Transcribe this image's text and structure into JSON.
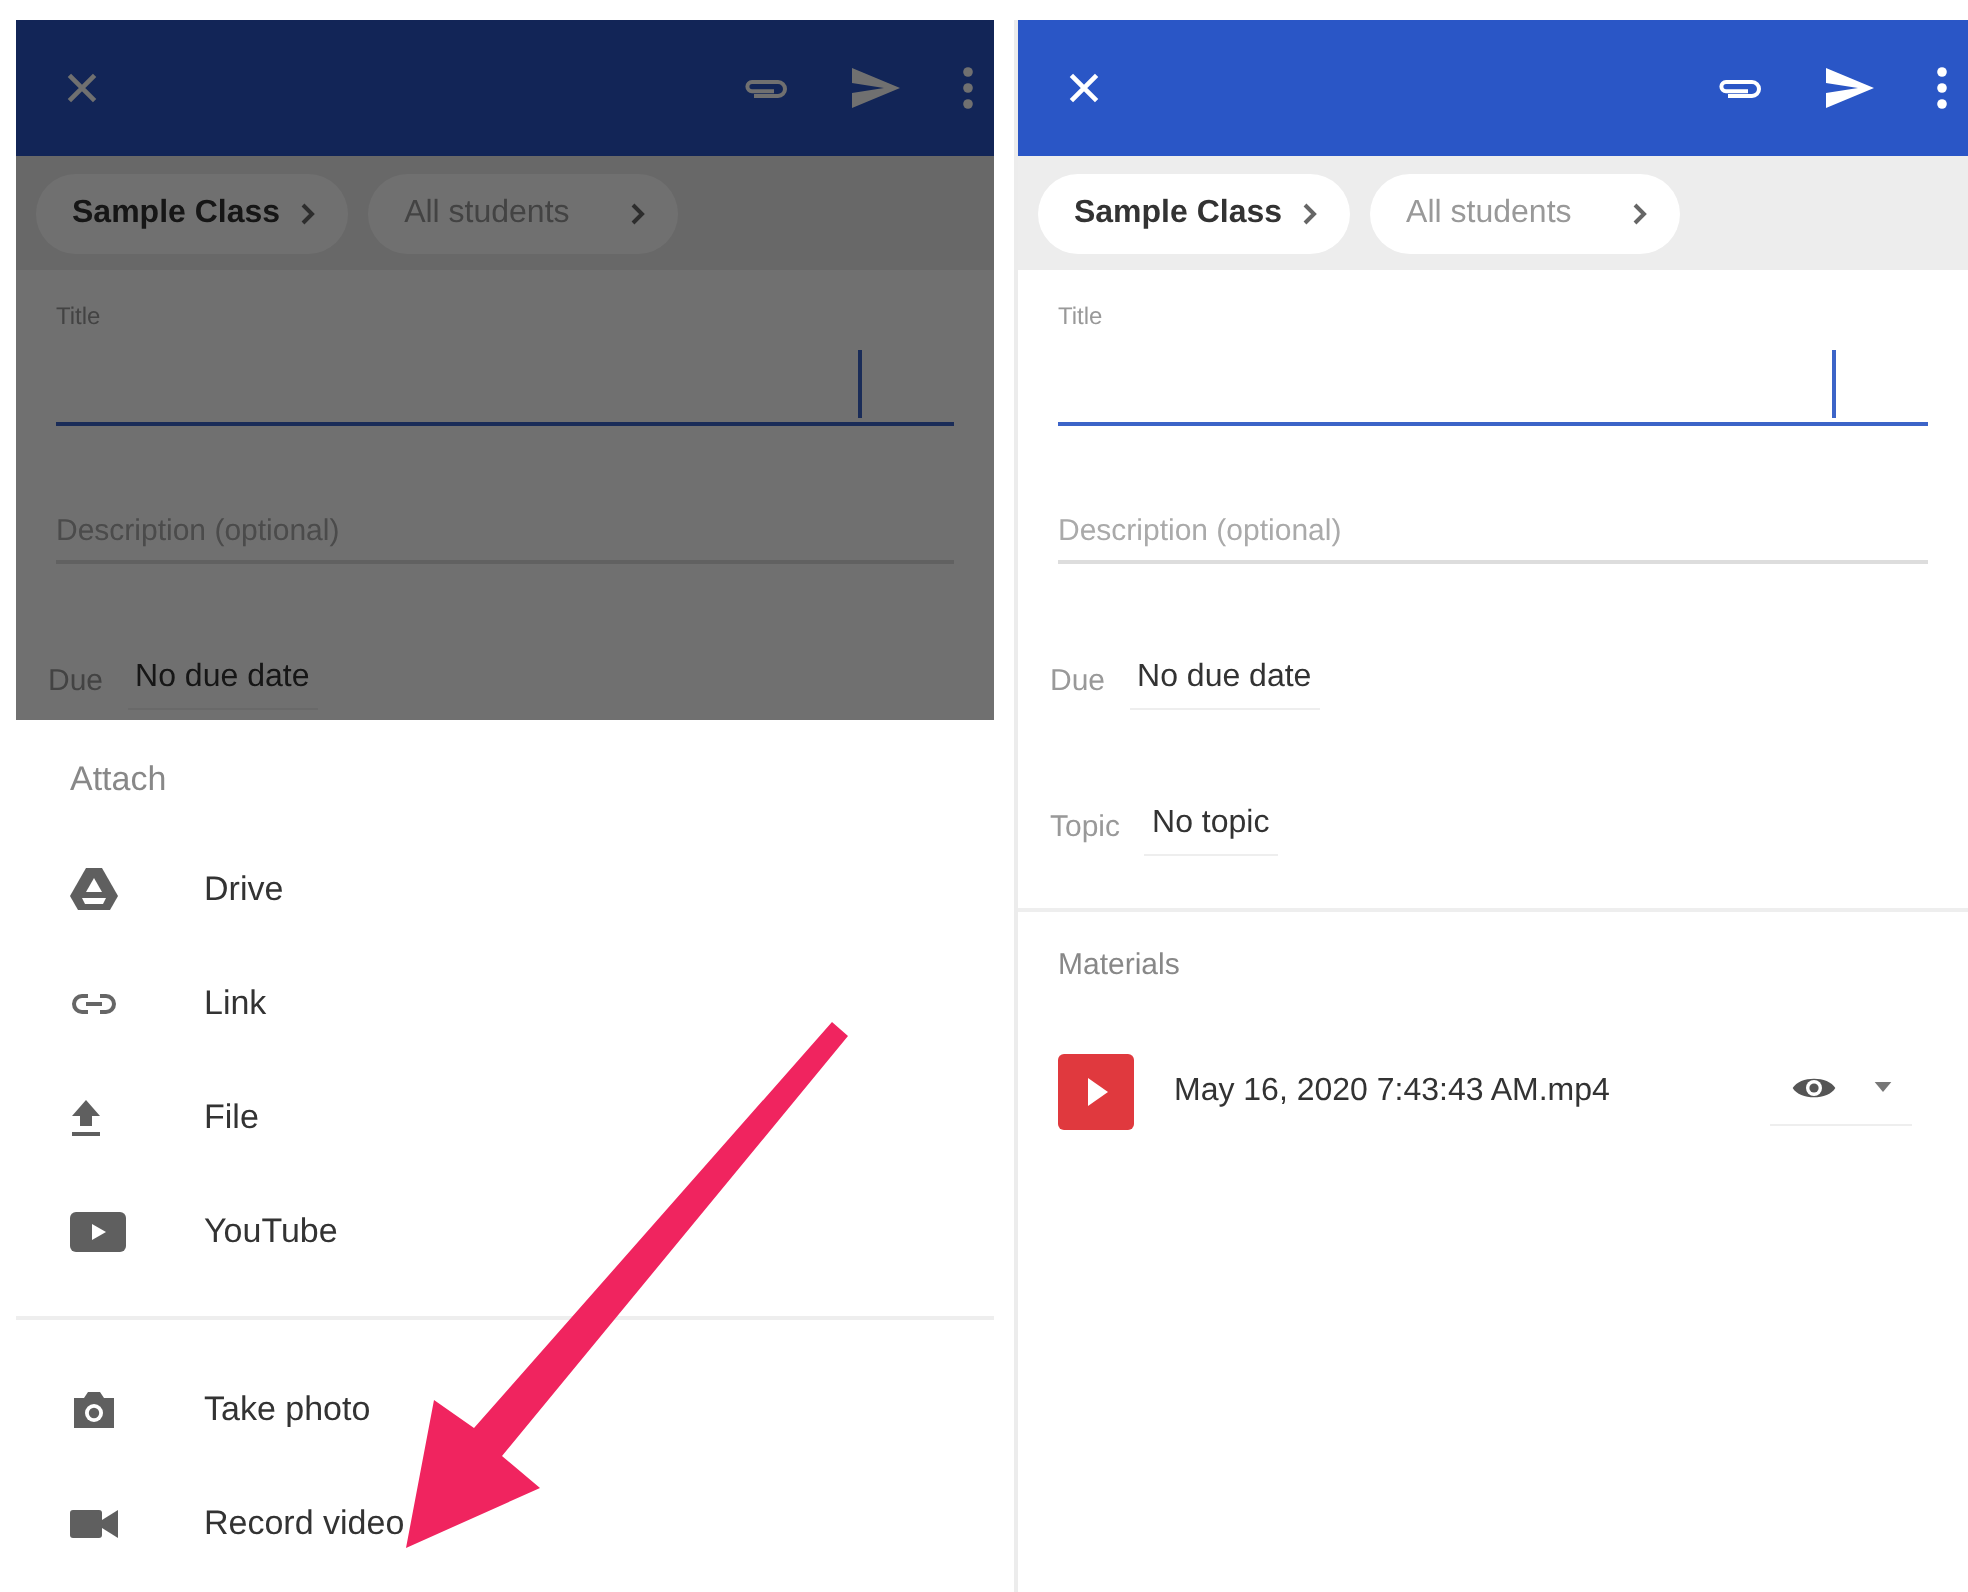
{
  "screens": [
    {
      "dimmed": true,
      "breadcrumbs": [
        "Sample Class",
        "All students"
      ],
      "title_label": "Title",
      "description": {
        "placeholder": "Description (optional)"
      },
      "due": {
        "label": "Due",
        "value": "No due date"
      },
      "sheet": {
        "title": "Attach",
        "sections": [
          [
            {
              "kind": "drive",
              "label": "Drive"
            },
            {
              "kind": "link",
              "label": "Link"
            },
            {
              "kind": "file",
              "label": "File"
            },
            {
              "kind": "youtube",
              "label": "YouTube"
            }
          ],
          [
            {
              "kind": "photo",
              "label": "Take photo"
            },
            {
              "kind": "video",
              "label": "Record video"
            }
          ]
        ]
      }
    },
    {
      "dimmed": false,
      "breadcrumbs": [
        "Sample Class",
        "All students"
      ],
      "title_label": "Title",
      "description": {
        "placeholder": "Description (optional)"
      },
      "due": {
        "label": "Due",
        "value": "No due date"
      },
      "topic": {
        "label": "Topic",
        "value": "No topic"
      },
      "materials": {
        "title": "Materials",
        "items": [
          {
            "kind": "video",
            "name": "May 16, 2020 7:43:43 AM.mp4"
          }
        ]
      }
    }
  ],
  "annotations": [
    {
      "kind": "arrow"
    }
  ]
}
